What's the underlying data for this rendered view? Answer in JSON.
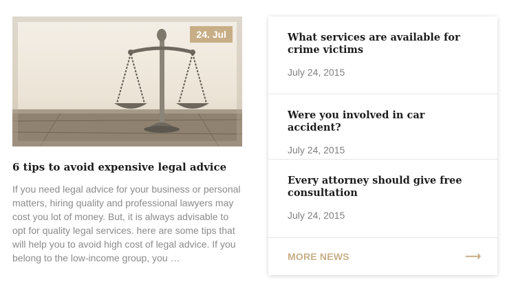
{
  "featured": {
    "image_alt": "scales of justice",
    "date_badge": "24. Jul",
    "title": "6 tips to avoid expensive legal advice",
    "excerpt": "If you need legal advice for your business or personal matters, hiring quality and professional lawyers may cost you lot of money. But, it is always advisable to opt for quality legal services. here are some tips that will help you to avoid high cost of legal advice. If you belong to the low-income group, you …"
  },
  "news": [
    {
      "title": "What services are available for crime victims",
      "date": "July 24, 2015"
    },
    {
      "title": "Were you involved in car accident?",
      "date": "July 24, 2015"
    },
    {
      "title": "Every attorney should give free consultation",
      "date": "July 24, 2015"
    }
  ],
  "more": {
    "label": "MORE NEWS",
    "icon": "arrow-right-icon"
  },
  "colors": {
    "accent": "#c8ae86",
    "text": "#1c1c1c",
    "muted": "#8a8a8a"
  }
}
